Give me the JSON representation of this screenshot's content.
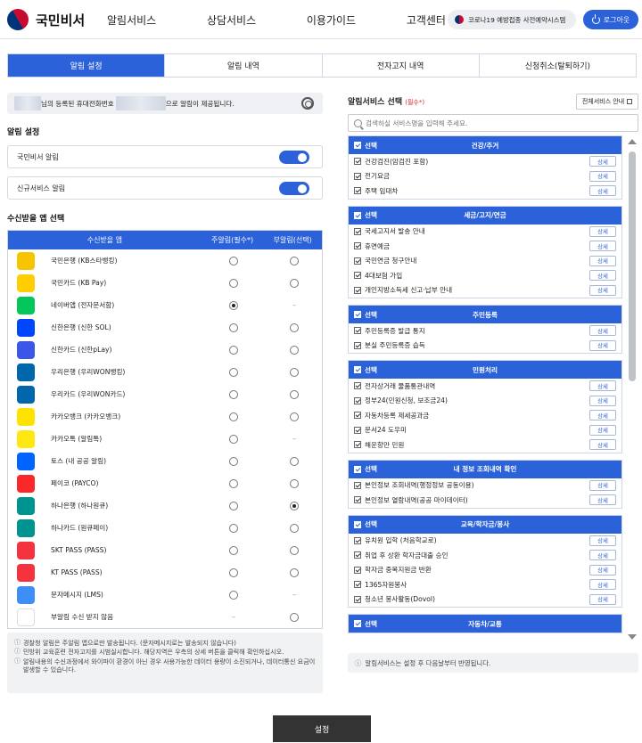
{
  "header": {
    "logo_text": "국민비서",
    "nav": [
      "알림서비스",
      "상담서비스",
      "이용가이드",
      "고객센터"
    ],
    "covid_label": "코로나19 예방접종 사전예약시스템",
    "logout_label": "로그아웃"
  },
  "tabs": [
    "알림 설정",
    "알림 내역",
    "전자고지 내역",
    "신청취소(탈퇴하기)"
  ],
  "notice": {
    "text_1": "님의 등록된 휴대전화번호",
    "text_2": "으로 알림이 제공됩니다."
  },
  "alert_settings": {
    "title": "알림 설정",
    "toggles": [
      {
        "label": "국민비서 알림",
        "on": true
      },
      {
        "label": "신규서비스 알림",
        "on": true
      }
    ]
  },
  "apps": {
    "title": "수신받을 앱 선택",
    "headers": [
      "수신받을 앱",
      "주알림(필수*)",
      "부알림(선택)"
    ],
    "rows": [
      {
        "name": "국민은행 (KB스타뱅킹)",
        "icon": "kb-star-icon",
        "color": "#f7c500",
        "main": "radio",
        "sub": "radio",
        "main_on": false,
        "sub_on": false
      },
      {
        "name": "국민카드 (KB Pay)",
        "icon": "kb-pay-icon",
        "color": "#ffcd00",
        "main": "radio",
        "sub": "radio",
        "main_on": false,
        "sub_on": false
      },
      {
        "name": "네이버앱 (전자문서함)",
        "icon": "naver-icon",
        "color": "#03c75a",
        "main": "radio",
        "sub": "dash",
        "main_on": true,
        "sub_on": false
      },
      {
        "name": "신한은행 (신한 SOL)",
        "icon": "shinhan-sol-icon",
        "color": "#0046ff",
        "main": "radio",
        "sub": "radio",
        "main_on": false,
        "sub_on": false
      },
      {
        "name": "신한카드 (신한pLay)",
        "icon": "shinhan-play-icon",
        "color": "#3a57e8",
        "main": "radio",
        "sub": "radio",
        "main_on": false,
        "sub_on": false
      },
      {
        "name": "우리은행 (우리WON뱅킹)",
        "icon": "woori-won-icon",
        "color": "#0067ac",
        "main": "radio",
        "sub": "radio",
        "main_on": false,
        "sub_on": false
      },
      {
        "name": "우리카드 (우리WON카드)",
        "icon": "woori-card-icon",
        "color": "#0067ac",
        "main": "radio",
        "sub": "radio",
        "main_on": false,
        "sub_on": false
      },
      {
        "name": "카카오뱅크 (카카오뱅크)",
        "icon": "kakaobank-icon",
        "color": "#ffe300",
        "main": "radio",
        "sub": "radio",
        "main_on": false,
        "sub_on": false
      },
      {
        "name": "카카오톡 (알림톡)",
        "icon": "kakaotalk-icon",
        "color": "#ffe812",
        "main": "radio",
        "sub": "dash",
        "main_on": false,
        "sub_on": false
      },
      {
        "name": "토스 (내 공공 알림)",
        "icon": "toss-icon",
        "color": "#0064ff",
        "main": "radio",
        "sub": "radio",
        "main_on": false,
        "sub_on": false
      },
      {
        "name": "페이코 (PAYCO)",
        "icon": "payco-icon",
        "color": "#fa2828",
        "main": "radio",
        "sub": "radio",
        "main_on": false,
        "sub_on": false
      },
      {
        "name": "하나은행 (하나원큐)",
        "icon": "hana-bank-icon",
        "color": "#009490",
        "main": "radio",
        "sub": "radio",
        "main_on": false,
        "sub_on": true
      },
      {
        "name": "하나카드 (원큐페이)",
        "icon": "hana-card-icon",
        "color": "#009490",
        "main": "radio",
        "sub": "radio",
        "main_on": false,
        "sub_on": false
      },
      {
        "name": "SKT PASS (PASS)",
        "icon": "skt-pass-icon",
        "color": "#f4333f",
        "main": "radio",
        "sub": "radio",
        "main_on": false,
        "sub_on": false
      },
      {
        "name": "KT PASS (PASS)",
        "icon": "kt-pass-icon",
        "color": "#f4333f",
        "main": "radio",
        "sub": "radio",
        "main_on": false,
        "sub_on": false
      },
      {
        "name": "문자메시지 (LMS)",
        "icon": "message-icon",
        "color": "#3e8ef7",
        "main": "radio",
        "sub": "dash",
        "main_on": false,
        "sub_on": false
      },
      {
        "name": "부알림 수신 받지 않음",
        "icon": "none-icon",
        "color": "#ffffff",
        "main": "dash",
        "sub": "radio",
        "main_on": false,
        "sub_on": false
      }
    ],
    "dash": "–"
  },
  "info_notes": [
    "경찰청 알림은 주알림 앱으로만 발송됩니다. (문자메시지로는 발송되지 않습니다)",
    "민방위 교육훈련 전자고지를 시범실시합니다. 해당지역은 우측의 상세 버튼을 클릭해 확인하십시오.",
    "알림내용의 수신과정에서 와이파이 환경이 아닌 경우 사용가능한 데이터 용량이 소진되거나, 데이터통신 요금이 발생할 수 있습니다."
  ],
  "services": {
    "title": "알림서비스 선택",
    "required": "(필수*)",
    "all_button": "전체서비스 안내",
    "search_placeholder": "검색하실 서비스명을 입력해 주세요.",
    "select_label": "선택",
    "detail_label": "상세",
    "categories": [
      {
        "title": "건강/주거",
        "items": [
          "건강검진(암검진 포함)",
          "전기요금",
          "주택 임대차"
        ]
      },
      {
        "title": "세금/고지/연금",
        "items": [
          "국세고지서 발송 안내",
          "휴면예금",
          "국민연금 청구안내",
          "4대보험 가입",
          "개인지방소득세 신고·납부 안내"
        ]
      },
      {
        "title": "주민등록",
        "items": [
          "주민등록증 발급 통지",
          "분실 주민등록증 습득"
        ]
      },
      {
        "title": "민원처리",
        "items": [
          "전자상거래 물품통관내역",
          "정부24(민원신청, 보조금24)",
          "자동차등록 제세공과금",
          "문서24 도우미",
          "해운항만 민원"
        ]
      },
      {
        "title": "내 정보 조회내역 확인",
        "items": [
          "본인정보 조회내역(행정정보 공동이용)",
          "본인정보 열람내역(공공 마이데이터)"
        ]
      },
      {
        "title": "교육/학자금/봉사",
        "items": [
          "유치원 입학 (처음학교로)",
          "취업 후 상환 학자금대출 승인",
          "학자금 중복지원금 반환",
          "1365자원봉사",
          "청소년 봉사활동(Dovol)"
        ]
      },
      {
        "title": "자동차/교통",
        "items": []
      }
    ],
    "note": "알림서비스는 설정 후 다음날부터 반영됩니다."
  },
  "submit_label": "설정",
  "colors": {
    "primary": "#2b62d9",
    "dark_button": "#333333",
    "required": "#d8232a"
  }
}
